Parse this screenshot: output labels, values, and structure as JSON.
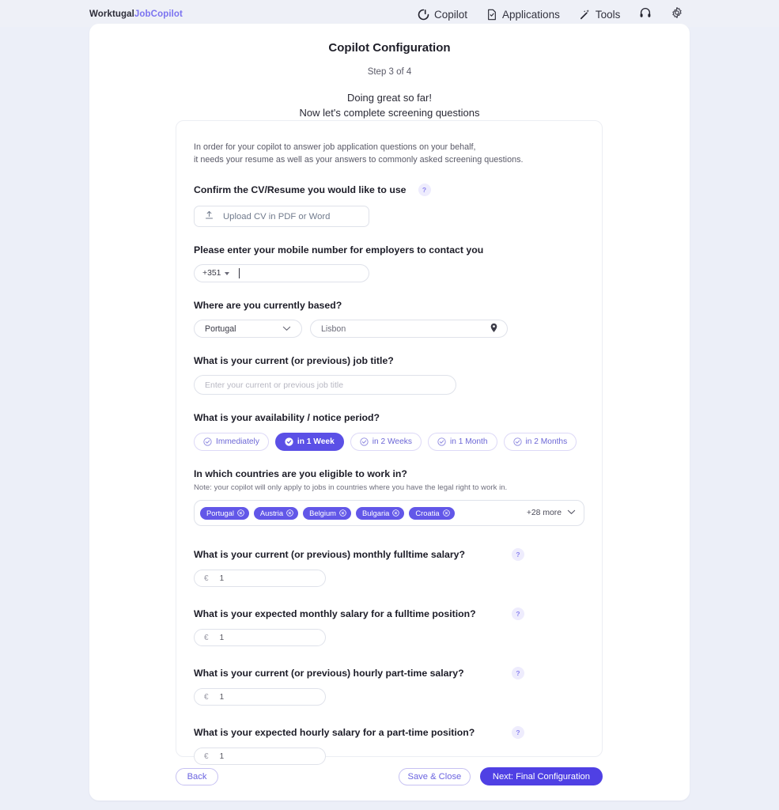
{
  "header": {
    "brand_primary": "Worktugal",
    "brand_secondary": "JobCopilot",
    "nav": [
      {
        "label": "Copilot",
        "icon": "copilot-icon"
      },
      {
        "label": "Applications",
        "icon": "document-check-icon"
      },
      {
        "label": "Tools",
        "icon": "magic-wand-icon"
      }
    ],
    "support_icon": "headset-icon",
    "settings_icon": "gear-icon"
  },
  "page": {
    "title": "Copilot Configuration",
    "step": "Step 3 of 4",
    "tagline_line1": "Doing great so far!",
    "tagline_line2": "Now let's complete screening questions"
  },
  "form": {
    "intro_line1": "In order for your copilot to answer job application questions on your behalf,",
    "intro_line2": "it needs your resume as well as your answers to commonly asked screening questions.",
    "cv": {
      "question": "Confirm the CV/Resume you would like to use",
      "help": "?",
      "upload_label": "Upload CV in PDF or Word",
      "upload_icon": "upload-icon"
    },
    "phone": {
      "question": "Please enter your mobile number for employers to contact you",
      "country_code": "+351",
      "value": ""
    },
    "location": {
      "question": "Where are you currently based?",
      "country": "Portugal",
      "city": "Lisbon",
      "city_icon": "map-pin-icon",
      "chevron_icon": "chevron-down-icon"
    },
    "job_title": {
      "question": "What is your current (or previous) job title?",
      "placeholder": "Enter your current or previous job title",
      "value": ""
    },
    "availability": {
      "question": "What is your availability / notice period?",
      "options": [
        {
          "label": "Immediately",
          "selected": false
        },
        {
          "label": "in 1 Week",
          "selected": true
        },
        {
          "label": "in 2 Weeks",
          "selected": false
        },
        {
          "label": "in 1 Month",
          "selected": false
        },
        {
          "label": "in 2 Months",
          "selected": false
        }
      ]
    },
    "countries": {
      "question": "In which countries are you eligible to work in?",
      "note": "Note: your copilot will only apply to jobs in countries where you have the legal right to work in.",
      "selected": [
        "Portugal",
        "Austria",
        "Belgium",
        "Bulgaria",
        "Croatia"
      ],
      "more_label": "+28 more",
      "remove_icon": "remove-circle-icon"
    },
    "salaries": [
      {
        "question": "What is your current (or previous) monthly fulltime salary?",
        "currency": "€",
        "value": "1",
        "help": "?"
      },
      {
        "question": "What is your expected monthly salary for a fulltime position?",
        "currency": "€",
        "value": "1",
        "help": "?"
      },
      {
        "question": "What is your current (or previous) hourly part-time salary?",
        "currency": "€",
        "value": "1",
        "help": "?"
      },
      {
        "question": "What is your expected hourly salary for a part-time position?",
        "currency": "€",
        "value": "1",
        "help": "?"
      }
    ]
  },
  "footer": {
    "back": "Back",
    "save_close": "Save & Close",
    "next": "Next: Final Configuration"
  },
  "colors": {
    "accent": "#4f40e4",
    "chip_selected": "#5b50e6",
    "tag": "#6257e8",
    "page_bg": "#eceff8",
    "brand_secondary": "#7b73f0"
  }
}
